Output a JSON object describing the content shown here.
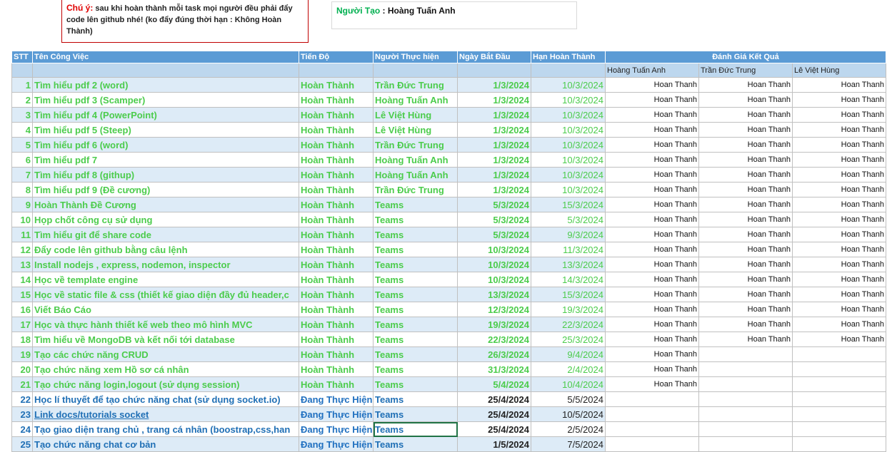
{
  "note": {
    "label": "Chú ý:",
    "text": "sau khi hoàn thành mỗi task mọi người đều phải đẩy code lên github nhé! (ko đẩy đúng thời hạn : Không Hoàn Thành)"
  },
  "author": {
    "label": "Người Tạo",
    "sep": " : ",
    "name": "Hoàng Tuấn Anh"
  },
  "headers": {
    "stt": "STT",
    "task": "Tên Công Việc",
    "progress": "Tiến Độ",
    "assignee": "Người Thực hiện",
    "start": "Ngày Bắt Đầu",
    "due": "Hạn Hoàn Thành",
    "eval": "Đánh Giá Kết Quả",
    "eval_cols": [
      "Hoàng Tuấn Anh",
      "Trần Đức Trung",
      "Lê Việt Hùng"
    ]
  },
  "rows": [
    {
      "stt": "1",
      "task": "Tìm hiểu pdf 2 (word)",
      "progress": "Hoàn Thành",
      "assignee": "Trần Đức Trung",
      "start": "1/3/2024",
      "due": "10/3/2024",
      "eval": [
        "Hoan Thanh",
        "Hoan Thanh",
        "Hoan Thanh"
      ],
      "status": "done"
    },
    {
      "stt": "2",
      "task": "Tìm hiểu pdf 3 (Scamper)",
      "progress": "Hoàn Thành",
      "assignee": "Hoàng Tuấn Anh",
      "start": "1/3/2024",
      "due": "10/3/2024",
      "eval": [
        "Hoan Thanh",
        "Hoan Thanh",
        "Hoan Thanh"
      ],
      "status": "done"
    },
    {
      "stt": "3",
      "task": "Tìm hiểu pdf 4 (PowerPoint)",
      "progress": "Hoàn Thành",
      "assignee": "Lê Việt Hùng",
      "start": "1/3/2024",
      "due": "10/3/2024",
      "eval": [
        "Hoan Thanh",
        "Hoan Thanh",
        "Hoan Thanh"
      ],
      "status": "done"
    },
    {
      "stt": "4",
      "task": "Tìm hiểu pdf 5 (Steep)",
      "progress": "Hoàn Thành",
      "assignee": "Lê Việt Hùng",
      "start": "1/3/2024",
      "due": "10/3/2024",
      "eval": [
        "Hoan Thanh",
        "Hoan Thanh",
        "Hoan Thanh"
      ],
      "status": "done"
    },
    {
      "stt": "5",
      "task": "Tìm hiểu pdf 6 (word)",
      "progress": "Hoàn Thành",
      "assignee": "Trần Đức Trung",
      "start": "1/3/2024",
      "due": "10/3/2024",
      "eval": [
        "Hoan Thanh",
        "Hoan Thanh",
        "Hoan Thanh"
      ],
      "status": "done"
    },
    {
      "stt": "6",
      "task": "Tìm hiểu pdf 7",
      "progress": "Hoàn Thành",
      "assignee": "Hoàng Tuấn Anh",
      "start": "1/3/2024",
      "due": "10/3/2024",
      "eval": [
        "Hoan Thanh",
        "Hoan Thanh",
        "Hoan Thanh"
      ],
      "status": "done"
    },
    {
      "stt": "7",
      "task": "Tìm hiểu pdf 8 (githup)",
      "progress": "Hoàn Thành",
      "assignee": "Hoàng Tuấn Anh",
      "start": "1/3/2024",
      "due": "10/3/2024",
      "eval": [
        "Hoan Thanh",
        "Hoan Thanh",
        "Hoan Thanh"
      ],
      "status": "done"
    },
    {
      "stt": "8",
      "task": "Tìm hiểu pdf 9 (Đề cương)",
      "progress": "Hoàn Thành",
      "assignee": "Trần Đức Trung",
      "start": "1/3/2024",
      "due": "10/3/2024",
      "eval": [
        "Hoan Thanh",
        "Hoan Thanh",
        "Hoan Thanh"
      ],
      "status": "done"
    },
    {
      "stt": "9",
      "task": "Hoàn Thành Đề Cương",
      "progress": "Hoàn Thành",
      "assignee": "Teams",
      "start": "5/3/2024",
      "due": "15/3/2024",
      "eval": [
        "Hoan Thanh",
        "Hoan Thanh",
        "Hoan Thanh"
      ],
      "status": "done"
    },
    {
      "stt": "10",
      "task": "Họp chốt công cụ sử dụng",
      "progress": "Hoàn Thành",
      "assignee": "Teams",
      "start": "5/3/2024",
      "due": "5/3/2024",
      "eval": [
        "Hoan Thanh",
        "Hoan Thanh",
        "Hoan Thanh"
      ],
      "status": "done"
    },
    {
      "stt": "11",
      "task": "Tìm hiểu git để share code",
      "progress": "Hoàn Thành",
      "assignee": "Teams",
      "start": "5/3/2024",
      "due": "9/3/2024",
      "eval": [
        "Hoan Thanh",
        "Hoan Thanh",
        "Hoan Thanh"
      ],
      "status": "done"
    },
    {
      "stt": "12",
      "task": "Đẩy code lên github bằng câu lệnh",
      "progress": "Hoàn Thành",
      "assignee": "Teams",
      "start": "10/3/2024",
      "due": "11/3/2024",
      "eval": [
        "Hoan Thanh",
        "Hoan Thanh",
        "Hoan Thanh"
      ],
      "status": "done"
    },
    {
      "stt": "13",
      "task": "Install nodejs , express, nodemon, inspector",
      "progress": "Hoàn Thành",
      "assignee": "Teams",
      "start": "10/3/2024",
      "due": "13/3/2024",
      "eval": [
        "Hoan Thanh",
        "Hoan Thanh",
        "Hoan Thanh"
      ],
      "status": "done"
    },
    {
      "stt": "14",
      "task": "Học về template engine",
      "progress": "Hoàn Thành",
      "assignee": "Teams",
      "start": "10/3/2024",
      "due": "14/3/2024",
      "eval": [
        "Hoan Thanh",
        "Hoan Thanh",
        "Hoan Thanh"
      ],
      "status": "done"
    },
    {
      "stt": "15",
      "task": "Học về static file & css (thiết kế giao diện đầy đủ header,c",
      "progress": "Hoàn Thành",
      "assignee": "Teams",
      "start": "13/3/2024",
      "due": "15/3/2024",
      "eval": [
        "Hoan Thanh",
        "Hoan Thanh",
        "Hoan Thanh"
      ],
      "status": "done"
    },
    {
      "stt": "16",
      "task": "Viết Báo Cáo",
      "progress": "Hoàn Thành",
      "assignee": "Teams",
      "start": "12/3/2024",
      "due": "19/3/2024",
      "eval": [
        "Hoan Thanh",
        "Hoan Thanh",
        "Hoan Thanh"
      ],
      "status": "done"
    },
    {
      "stt": "17",
      "task": "Học và thực hành thiết kế web theo mô hình MVC",
      "progress": "Hoàn Thành",
      "assignee": "Teams",
      "start": "19/3/2024",
      "due": "22/3/2024",
      "eval": [
        "Hoan Thanh",
        "Hoan Thanh",
        "Hoan Thanh"
      ],
      "status": "done"
    },
    {
      "stt": "18",
      "task": "Tìm hiểu về MongoDB và kết nối tới database",
      "progress": "Hoàn Thành",
      "assignee": "Teams",
      "start": "22/3/2024",
      "due": "25/3/2024",
      "eval": [
        "Hoan Thanh",
        "Hoan Thanh",
        "Hoan Thanh"
      ],
      "status": "done"
    },
    {
      "stt": "19",
      "task": "Tạo các chức năng CRUD",
      "progress": "Hoàn Thành",
      "assignee": "Teams",
      "start": "26/3/2024",
      "due": "9/4/2024",
      "eval": [
        "Hoan Thanh",
        "",
        ""
      ],
      "status": "done"
    },
    {
      "stt": "20",
      "task": "Tạo chức năng xem Hồ sơ cá nhân",
      "progress": "Hoàn Thành",
      "assignee": "Teams",
      "start": "31/3/2024",
      "due": "2/4/2024",
      "eval": [
        "Hoan Thanh",
        "",
        ""
      ],
      "status": "done"
    },
    {
      "stt": "21",
      "task": "Tạo chức năng login,logout (sử dụng session)",
      "progress": "Hoàn Thành",
      "assignee": "Teams",
      "start": "5/4/2024",
      "due": "10/4/2024",
      "eval": [
        "Hoan Thanh",
        "",
        ""
      ],
      "status": "done"
    },
    {
      "stt": "22",
      "task": "Học lí thuyết để tạo chức năng chat (sử dụng socket.io)",
      "progress": "Đang Thực Hiện",
      "assignee": "Teams",
      "start": "25/4/2024",
      "due": "5/5/2024",
      "eval": [
        "",
        "",
        ""
      ],
      "status": "wip"
    },
    {
      "stt": "23",
      "task": "Link docs/tutorials socket ",
      "progress": "Đang Thực Hiện",
      "assignee": "Teams",
      "start": "25/4/2024",
      "due": "10/5/2024",
      "eval": [
        "",
        "",
        ""
      ],
      "status": "wip",
      "link": true
    },
    {
      "stt": "24",
      "task": "Tạo giao diện trang chủ , trang cá nhân (boostrap,css,han",
      "progress": "Đang Thực Hiện",
      "assignee": "Teams",
      "start": "25/4/2024",
      "due": "2/5/2024",
      "eval": [
        "",
        "",
        ""
      ],
      "status": "wip"
    },
    {
      "stt": "25",
      "task": "Tạo chức năng chat cơ bản",
      "progress": "Đang Thực Hiện",
      "assignee": "Teams",
      "start": "1/5/2024",
      "due": "7/5/2024",
      "eval": [
        "",
        "",
        ""
      ],
      "status": "wip"
    }
  ]
}
